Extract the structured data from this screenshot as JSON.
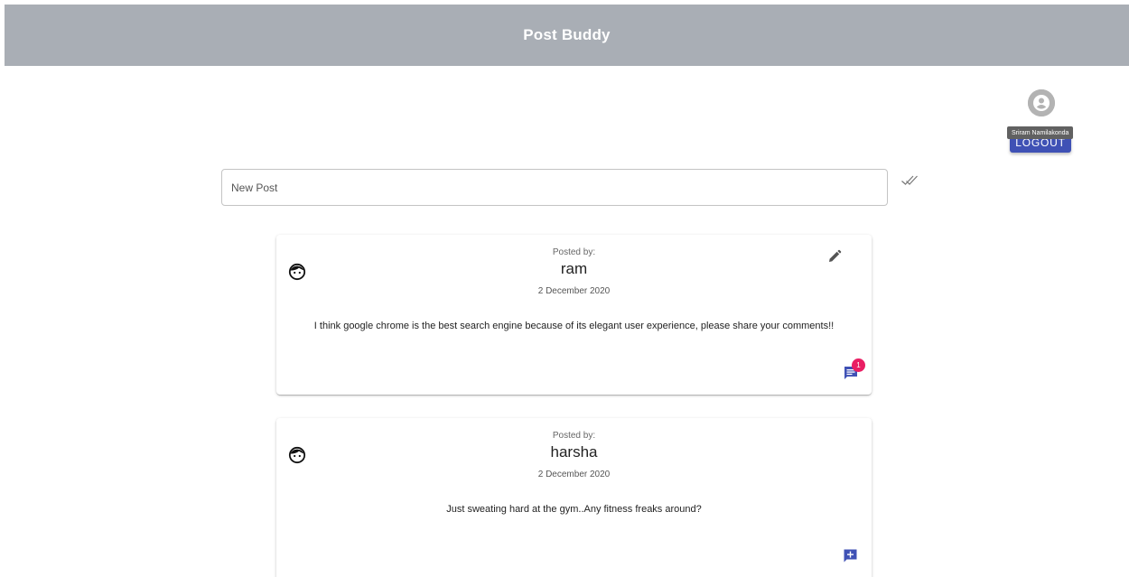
{
  "app": {
    "title": "Post Buddy"
  },
  "user": {
    "name": "Sriram Namilakonda",
    "logout_label": "LOGOUT"
  },
  "new_post": {
    "placeholder": "New Post",
    "value": ""
  },
  "posts": [
    {
      "posted_by_label": "Posted by:",
      "author": "ram",
      "date": "2 December 2020",
      "body": "I think google chrome is the best search engine because of its elegant user experience, please share your comments!!",
      "comment_count": "1"
    },
    {
      "posted_by_label": "Posted by:",
      "author": "harsha",
      "date": "2 December 2020",
      "body": "Just sweating hard at the gym..Any fitness freaks around?"
    }
  ],
  "colors": {
    "app_bar": "#a9aeb5",
    "primary": "#3f51b5",
    "badge": "#e91e63"
  },
  "icons": {
    "account": "account-circle-icon",
    "submit": "done-all-icon",
    "avatar": "face-icon",
    "edit": "pencil-icon",
    "comment": "comment-icon",
    "add_comment": "add-comment-icon"
  }
}
